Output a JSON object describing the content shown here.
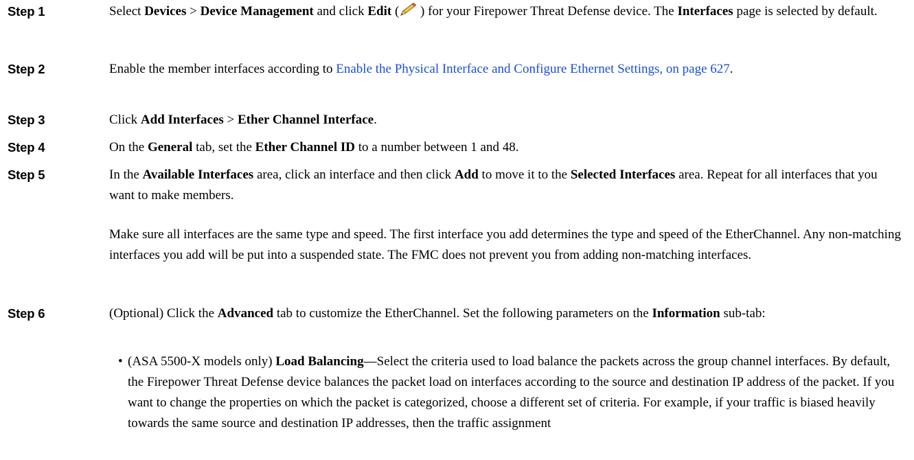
{
  "steps": [
    {
      "label": "Step 1",
      "parts": [
        {
          "t": "Select "
        },
        {
          "b": "Devices"
        },
        {
          "t": " > "
        },
        {
          "b": "Device Management"
        },
        {
          "t": " and click "
        },
        {
          "b": "Edit"
        },
        {
          "t": " ("
        },
        {
          "icon": "edit-pencil-icon"
        },
        {
          "t": " ) for your Firepower Threat Defense device. The "
        },
        {
          "b": "Interfaces"
        },
        {
          "t": " page is selected by default."
        }
      ]
    },
    {
      "label": "Step 2",
      "parts": [
        {
          "t": "Enable the member interfaces according to "
        },
        {
          "link": "Enable the Physical Interface and Configure Ethernet Settings, on page 627"
        },
        {
          "t": "."
        }
      ]
    },
    {
      "label": "Step 3",
      "parts": [
        {
          "t": "Click "
        },
        {
          "b": "Add Interfaces"
        },
        {
          "t": " > "
        },
        {
          "b": "Ether Channel Interface"
        },
        {
          "t": "."
        }
      ]
    },
    {
      "label": "Step 4",
      "parts": [
        {
          "t": "On the "
        },
        {
          "b": "General"
        },
        {
          "t": " tab, set the "
        },
        {
          "b": "Ether Channel ID"
        },
        {
          "t": " to a number between 1 and 48."
        }
      ]
    },
    {
      "label": "Step 5",
      "parts": [
        {
          "t": "In the "
        },
        {
          "b": "Available Interfaces"
        },
        {
          "t": " area, click an interface and then click "
        },
        {
          "b": "Add"
        },
        {
          "t": " to move it to the "
        },
        {
          "b": "Selected Interfaces"
        },
        {
          "t": " area. Repeat for all interfaces that you want to make members."
        }
      ],
      "note": "Make sure all interfaces are the same type and speed. The first interface you add determines the type and speed of the EtherChannel. Any non-matching interfaces you add will be put into a suspended state. The FMC does not prevent you from adding non-matching interfaces."
    },
    {
      "label": "Step 6",
      "parts": [
        {
          "t": "(Optional) Click the "
        },
        {
          "b": "Advanced"
        },
        {
          "t": " tab to customize the EtherChannel. Set the following parameters on the "
        },
        {
          "b": "Information"
        },
        {
          "t": " sub-tab:"
        }
      ],
      "bullets": [
        [
          {
            "t": "(ASA 5500-X models only) "
          },
          {
            "b": "Load Balancing"
          },
          {
            "t": "—Select the criteria used to load balance the packets across the group channel interfaces. By default, the Firepower Threat Defense device balances the packet load on interfaces according to the source and destination IP address of the packet. If you want to change the properties on which the packet is categorized, choose a different set of criteria. For example, if your traffic is biased heavily towards the same source and destination IP addresses, then the traffic assignment"
          }
        ]
      ]
    }
  ]
}
